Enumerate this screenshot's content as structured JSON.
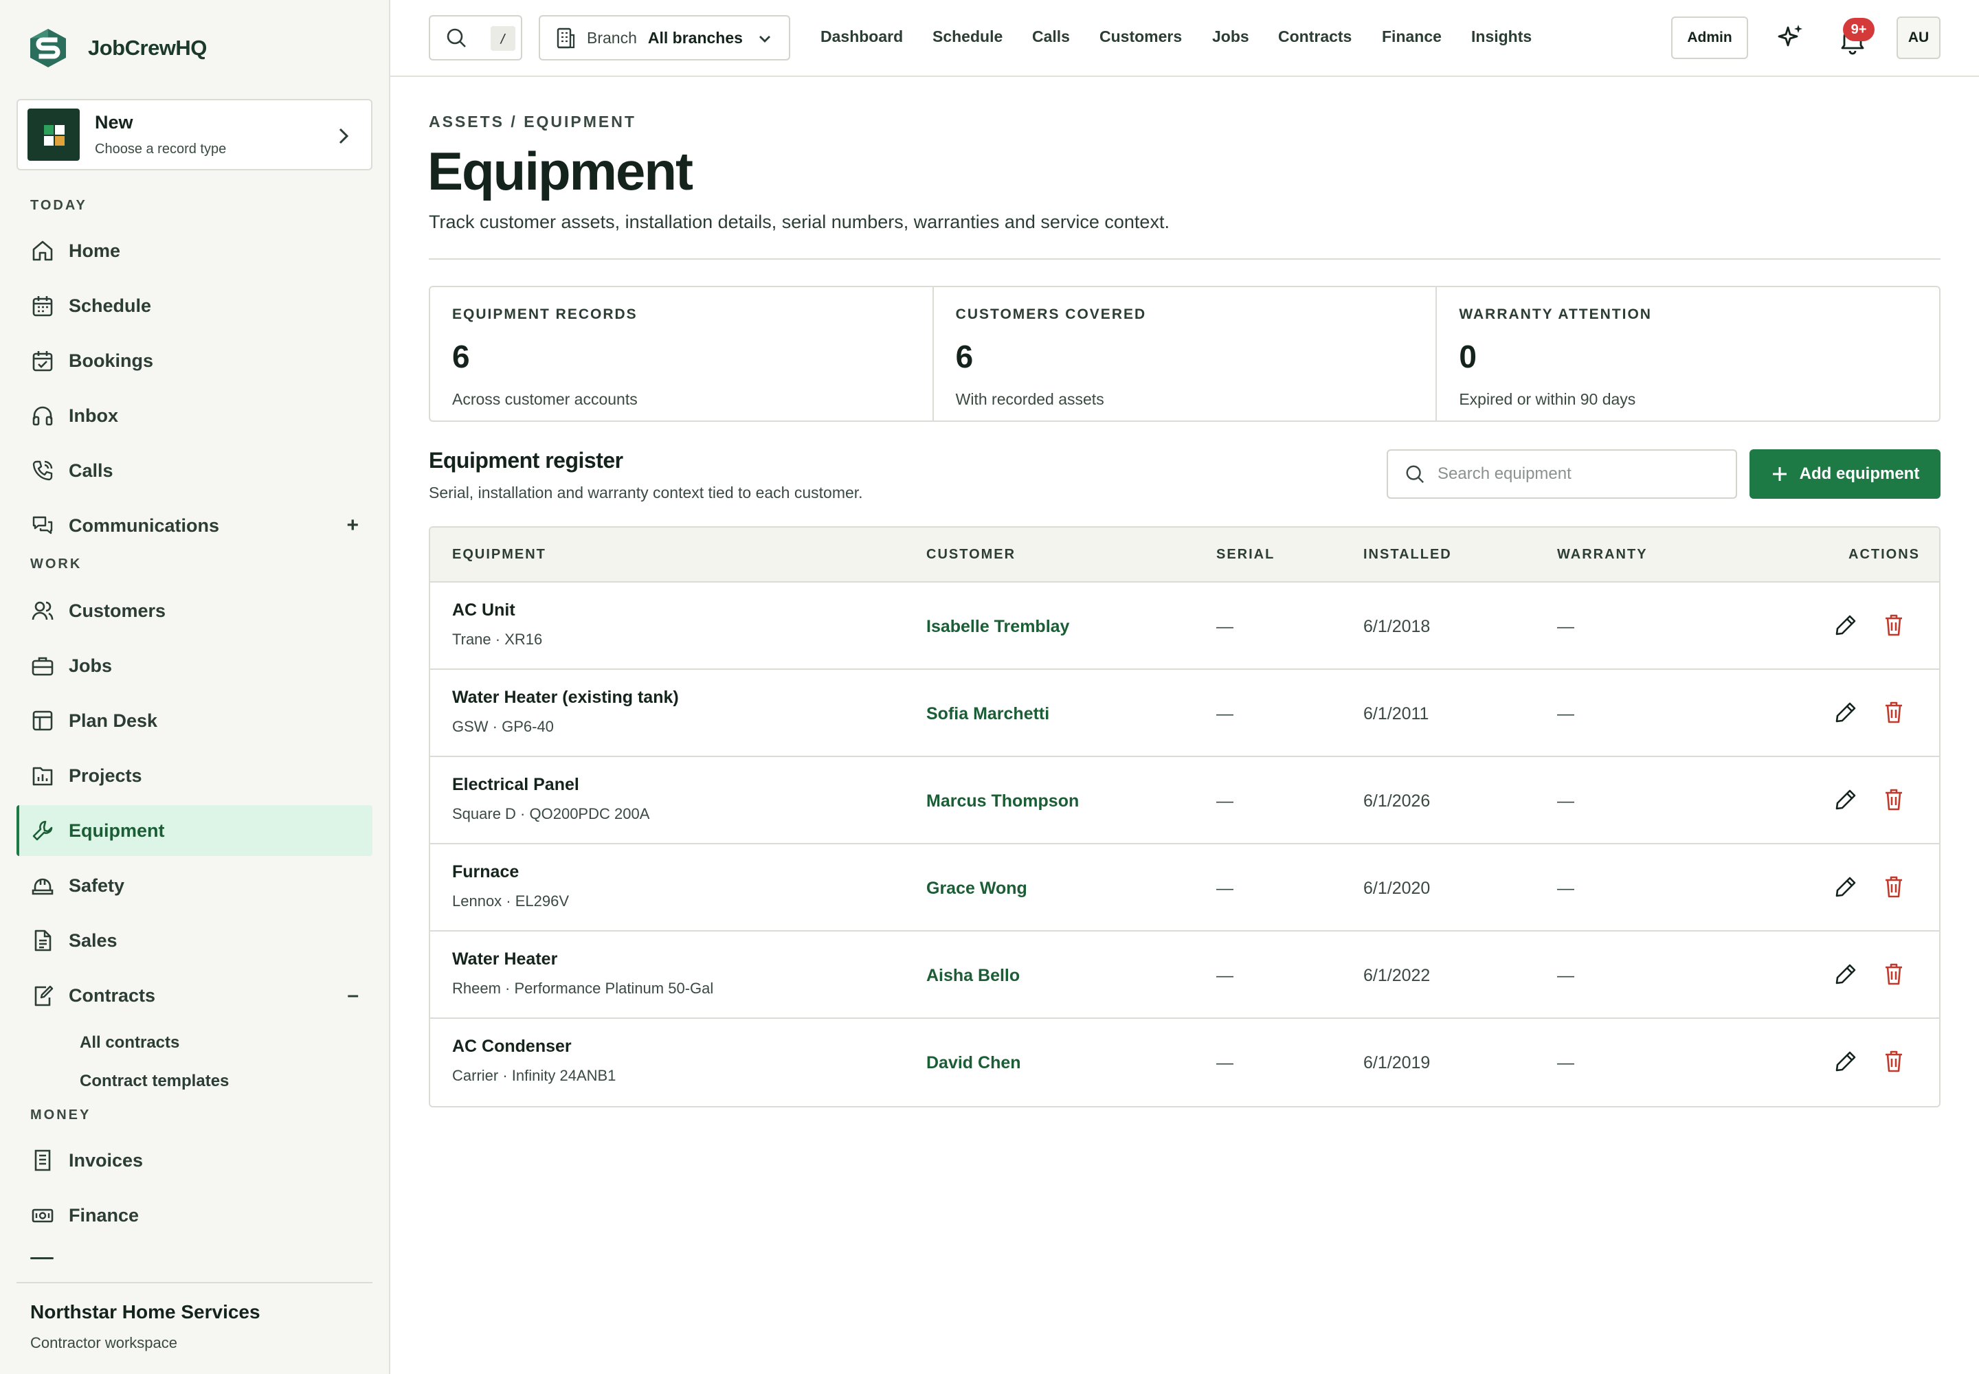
{
  "brand": {
    "name": "JobCrewHQ"
  },
  "new_card": {
    "title": "New",
    "subtitle": "Choose a record type"
  },
  "sidebar": {
    "sections": {
      "today": "TODAY",
      "work": "WORK",
      "money": "MONEY"
    },
    "items": {
      "home": "Home",
      "schedule": "Schedule",
      "bookings": "Bookings",
      "inbox": "Inbox",
      "calls": "Calls",
      "communications": "Communications",
      "customers": "Customers",
      "jobs": "Jobs",
      "plan_desk": "Plan Desk",
      "projects": "Projects",
      "equipment": "Equipment",
      "safety": "Safety",
      "sales": "Sales",
      "contracts": "Contracts",
      "invoices": "Invoices",
      "finance": "Finance"
    },
    "communications_toggle": "+",
    "contracts_toggle": "–",
    "contracts_sub": [
      "All contracts",
      "Contract templates"
    ],
    "active": "equipment"
  },
  "workspace": {
    "name": "Northstar Home Services",
    "type": "Contractor workspace"
  },
  "topbar": {
    "search_shortcut": "/",
    "branch_label": "Branch",
    "branch_value": "All branches",
    "nav": [
      "Dashboard",
      "Schedule",
      "Calls",
      "Customers",
      "Jobs",
      "Contracts",
      "Finance",
      "Insights"
    ],
    "admin_label": "Admin",
    "notifications_badge": "9+",
    "avatar_initials": "AU"
  },
  "page": {
    "breadcrumb": "ASSETS / EQUIPMENT",
    "title": "Equipment",
    "subtitle": "Track customer assets, installation details, serial numbers, warranties and service context."
  },
  "stats": [
    {
      "label": "EQUIPMENT RECORDS",
      "value": "6",
      "note": "Across customer accounts"
    },
    {
      "label": "CUSTOMERS COVERED",
      "value": "6",
      "note": "With recorded assets"
    },
    {
      "label": "WARRANTY ATTENTION",
      "value": "0",
      "note": "Expired or within 90 days"
    }
  ],
  "register": {
    "title": "Equipment register",
    "subtitle": "Serial, installation and warranty context tied to each customer.",
    "search_placeholder": "Search equipment",
    "add_label": "Add equipment"
  },
  "table": {
    "columns": [
      "EQUIPMENT",
      "CUSTOMER",
      "SERIAL",
      "INSTALLED",
      "WARRANTY",
      "ACTIONS"
    ],
    "rows": [
      {
        "name": "AC Unit",
        "model": "Trane · XR16",
        "customer": "Isabelle Tremblay",
        "serial": "—",
        "installed": "6/1/2018",
        "warranty": "—"
      },
      {
        "name": "Water Heater (existing tank)",
        "model": "GSW · GP6-40",
        "customer": "Sofia Marchetti",
        "serial": "—",
        "installed": "6/1/2011",
        "warranty": "—"
      },
      {
        "name": "Electrical Panel",
        "model": "Square D · QO200PDC 200A",
        "customer": "Marcus Thompson",
        "serial": "—",
        "installed": "6/1/2026",
        "warranty": "—"
      },
      {
        "name": "Furnace",
        "model": "Lennox · EL296V",
        "customer": "Grace Wong",
        "serial": "—",
        "installed": "6/1/2020",
        "warranty": "—"
      },
      {
        "name": "Water Heater",
        "model": "Rheem · Performance Platinum 50-Gal",
        "customer": "Aisha Bello",
        "serial": "—",
        "installed": "6/1/2022",
        "warranty": "—"
      },
      {
        "name": "AC Condenser",
        "model": "Carrier · Infinity 24ANB1",
        "customer": "David Chen",
        "serial": "—",
        "installed": "6/1/2019",
        "warranty": "—"
      }
    ]
  },
  "colors": {
    "accent": "#1e7a45",
    "accent_text": "#1b5e36",
    "active_bg": "#dcf5e7",
    "danger": "#c0392b",
    "badge": "#d43a3a"
  },
  "icons": {
    "search": "search-icon",
    "branch": "building-icon",
    "chevron": "chevron-down-icon",
    "sparkle": "sparkle-icon",
    "bell": "bell-icon",
    "edit": "pencil-icon",
    "delete": "trash-icon"
  }
}
